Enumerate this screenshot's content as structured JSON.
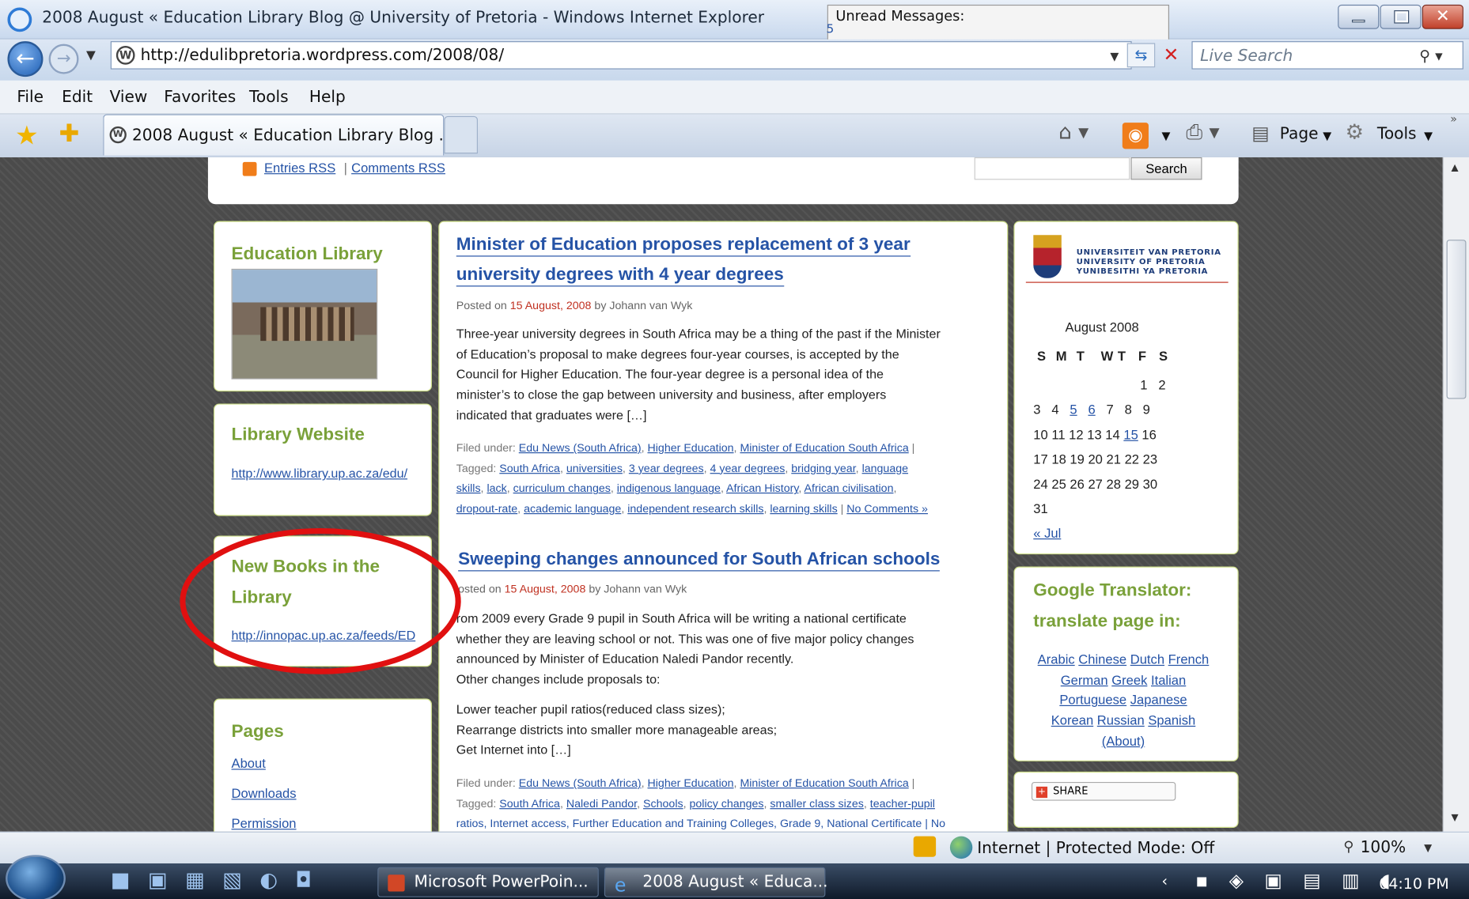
{
  "window": {
    "title": "2008 August « Education Library Blog @ University of Pretoria - Windows Internet Explorer",
    "unread_label": "Unread Messages:",
    "unread_count": "5"
  },
  "address_bar": {
    "url": "http://edulibpretoria.wordpress.com/2008/08/",
    "search_placeholder": "Live Search"
  },
  "menu": [
    "File",
    "Edit",
    "View",
    "Favorites",
    "Tools",
    "Help"
  ],
  "tab": {
    "label": "2008 August « Education Library Blog ..."
  },
  "command_bar": {
    "page_label": "Page",
    "tools_label": "Tools"
  },
  "blog": {
    "rss": {
      "entries": "Entries RSS",
      "separator": "|",
      "comments": "Comments RSS"
    },
    "search_button": "Search",
    "left": {
      "w1_title": "Education Library",
      "w2_title": "Library Website",
      "w2_link": "http://www.library.up.ac.za/edu/",
      "w3_title_line1": "New Books in the",
      "w3_title_line2": "Library",
      "w3_link": "http://innopac.up.ac.za/feeds/ED",
      "w4_title": "Pages",
      "w4_links": [
        "About",
        "Downloads",
        "Permission"
      ]
    },
    "posts": [
      {
        "title_line1": "Minister of Education proposes replacement of 3 year",
        "title_line2": "university degrees with 4 year degrees",
        "posted_on": "Posted on",
        "date": "15 August, 2008",
        "by": "by Johann van Wyk",
        "body": [
          "Three-year university degrees in South Africa may be a thing of the past if the Minister",
          "of Education’s proposal to make degrees four-year courses, is accepted by the",
          "Council for Higher Education. The four-year degree is a personal idea of the",
          "minister’s to close the gap between university and business, after employers",
          "indicated that graduates were […]"
        ],
        "filed_under": "Filed under:",
        "categories": [
          "Edu News (South Africa)",
          "Higher Education",
          "Minister of Education South Africa"
        ],
        "tagged": "Tagged:",
        "tags_line1": [
          "South Africa",
          "universities",
          "3 year degrees",
          "4 year degrees",
          "bridging year",
          "language"
        ],
        "tags_line2": [
          "skills",
          "lack",
          "curriculum changes",
          "indigenous language",
          "African History",
          "African civilisation"
        ],
        "tags_line3": [
          "dropout-rate",
          "academic language",
          "independent research skills",
          "learning skills"
        ],
        "comments": "No Comments »"
      },
      {
        "title": "Sweeping changes announced for South African schools",
        "posted_on": "osted on",
        "date": "15 August, 2008",
        "by": "by Johann van Wyk",
        "body": [
          "rom 2009 every Grade 9 pupil in South Africa will be writing a national certificate",
          "whether they are leaving school or not. This was one of five major policy changes",
          "announced by Minister of Education Naledi Pandor recently.",
          "Other changes include proposals to:"
        ],
        "body2": [
          "Lower teacher pupil ratios(reduced class sizes);",
          "Rearrange districts into smaller more manageable areas;",
          "Get Internet into […]"
        ],
        "filed_under": "Filed under:",
        "categories": [
          "Edu News (South Africa)",
          "Higher Education",
          "Minister of Education South Africa"
        ],
        "tagged": "Tagged:",
        "tags_line1": [
          "South Africa",
          "Naledi Pandor",
          "Schools",
          "policy changes",
          "smaller class sizes",
          "teacher-pupil"
        ],
        "tags_line2": "ratios, Internet access, Further Education and Training Colleges, Grade 9, National Certificate | No"
      }
    ],
    "right": {
      "logo_lines": [
        "UNIVERSITEIT VAN PRETORIA",
        "UNIVERSITY OF PRETORIA",
        "YUNIBESITHI YA PRETORIA"
      ],
      "calendar": {
        "caption": "August 2008",
        "days": [
          "S",
          "M",
          "T",
          "W",
          "T",
          "F",
          "S"
        ],
        "rows": [
          [
            "",
            "",
            "",
            "",
            "",
            "1",
            "2"
          ],
          [
            "3",
            "4",
            "5",
            "6",
            "7",
            "8",
            "9"
          ],
          [
            "10",
            "11",
            "12",
            "13",
            "14",
            "15",
            "16"
          ],
          [
            "17",
            "18",
            "19",
            "20",
            "21",
            "22",
            "23"
          ],
          [
            "24",
            "25",
            "26",
            "27",
            "28",
            "29",
            "30"
          ],
          [
            "31",
            "",
            "",
            "",
            "",
            "",
            ""
          ]
        ],
        "linked_days": [
          "5",
          "6",
          "15"
        ],
        "prev": "« Jul"
      },
      "translator_title_line1": "Google Translator:",
      "translator_title_line2": "translate page in:",
      "lang_line1": [
        "Arabic",
        "Chinese",
        "Dutch",
        "French"
      ],
      "lang_line2": [
        "German",
        "Greek",
        "Italian"
      ],
      "lang_line3": [
        "Portuguese",
        "Japanese"
      ],
      "lang_line4": [
        "Korean",
        "Russian",
        "Spanish"
      ],
      "about": "(About)",
      "share": "SHARE"
    }
  },
  "status_bar": {
    "zone": "Internet | Protected Mode: Off",
    "zoom": "100%"
  },
  "taskbar": {
    "task1": "Microsoft PowerPoin...",
    "task2": "2008 August « Educa...",
    "clock": "04:10 PM"
  },
  "colors": {
    "widget_title": "#7aa13a",
    "link": "#2553a6",
    "date": "#c03020",
    "annotation_ellipse": "#e01010"
  }
}
